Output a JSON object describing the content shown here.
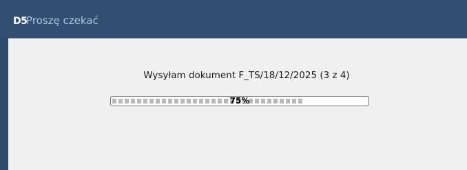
{
  "window": {
    "logo_text": "D5",
    "title": "Proszę czekać"
  },
  "status": {
    "message": "Wysyłam dokument F_TS/18/12/2025 (3 z 4)"
  },
  "progress": {
    "value_percent": 75,
    "label": "75%"
  },
  "colors": {
    "titlebar": "#314f70",
    "title_text": "#a9c6e3",
    "content_bg": "#f0f0f0",
    "progress_segment": "#b9b9b9"
  }
}
